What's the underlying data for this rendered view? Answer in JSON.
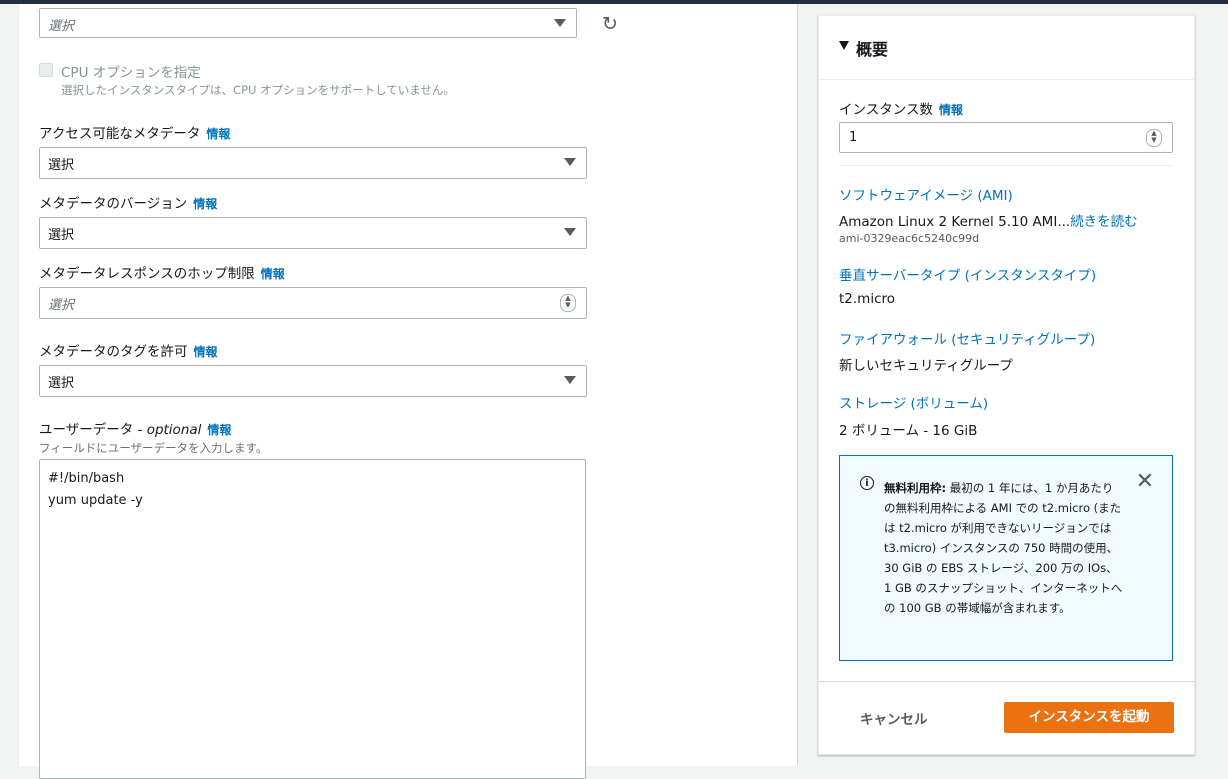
{
  "top_select": {
    "placeholder": "選択"
  },
  "cpu_option": {
    "label": "CPU オプションを指定",
    "description": "選択したインスタンスタイプは、CPU オプションをサポートしていません。"
  },
  "fields": [
    {
      "label": "アクセス可能なメタデータ",
      "info": "情報",
      "value": "選択"
    },
    {
      "label": "メタデータのバージョン",
      "info": "情報",
      "value": "選択"
    },
    {
      "label": "メタデータレスポンスのホップ制限",
      "info": "情報",
      "value": "選択"
    },
    {
      "label": "メタデータのタグを許可",
      "info": "情報",
      "value": "選択"
    }
  ],
  "user_data": {
    "label": "ユーザーデータ",
    "optional": " - optional",
    "info": "情報",
    "hint": "フィールドにユーザーデータを入力します。",
    "lines": [
      "#!/bin/bash",
      "yum update -y"
    ]
  },
  "summary": {
    "title": "概要",
    "instance_count_label": "インスタンス数",
    "instance_count_info": "情報",
    "instance_count_value": "1",
    "ami_link": "ソフトウェアイメージ (AMI)",
    "ami_value": "Amazon Linux 2 Kernel 5.10 AMI...",
    "ami_more": "続きを読む",
    "ami_id": "ami-0329eac6c5240c99d",
    "type_link": "垂直サーバータイプ (インスタンスタイプ)",
    "type_value": "t2.micro",
    "firewall_link": "ファイアウォール (セキュリティグループ)",
    "firewall_value": "新しいセキュリティグループ",
    "storage_link": "ストレージ (ボリューム)",
    "storage_value": "2 ボリューム - 16 GiB",
    "free_tier_title": "無料利用枠:",
    "free_tier_text": " 最初の 1 年には、1 か月あたりの無料利用枠による AMI での t2.micro (または t2.micro が利用できないリージョンでは t3.micro) インスタンスの 750 時間の使用、30 GiB の EBS ストレージ、200 万の IOs、1 GB のスナップショット、インターネットへの 100 GB の帯域幅が含まれます。",
    "cancel": "キャンセル",
    "launch": "インスタンスを起動"
  }
}
